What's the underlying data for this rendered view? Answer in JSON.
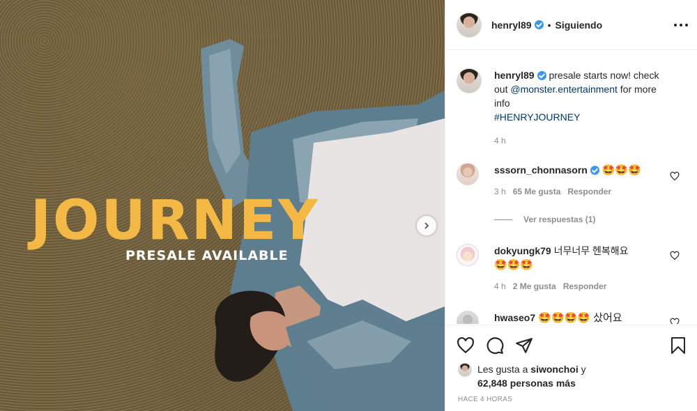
{
  "media": {
    "title": "JOURNEY",
    "subtitle": "PRESALE AVAILABLE",
    "next_icon": "chevron-right-icon"
  },
  "header": {
    "username": "henryl89",
    "separator": "•",
    "follow_status": "Siguiendo",
    "more_icon": "more-horizontal-icon"
  },
  "caption": {
    "username": "henryl89",
    "text": " presale starts now! check out ",
    "mention": "@monster.entertainment",
    "text_after": " for more info",
    "hashtag": "#HENRYJOURNEY",
    "time": "4 h"
  },
  "comments": [
    {
      "username": "sssorn_chonnasorn",
      "verified": true,
      "text": "🤩🤩🤩",
      "time": "3 h",
      "likes": "65 Me gusta",
      "reply": "Responder",
      "view_replies": "Ver respuestas (1)"
    },
    {
      "username": "dokyungk79",
      "text": " 너무너무 헨복해요",
      "text2": "🤩🤩🤩",
      "time": "4 h",
      "likes": "2 Me gusta",
      "reply": "Responder"
    },
    {
      "username": "hwaseo7",
      "text": " 🤩🤩🤩🤩 샀어요"
    }
  ],
  "actions": {
    "like_icon": "heart-icon",
    "comment_icon": "comment-icon",
    "share_icon": "send-icon",
    "save_icon": "bookmark-icon"
  },
  "likes": {
    "prefix": "Les gusta a ",
    "user": "siwonchoi",
    "mid": " y",
    "count": "62,848 personas más"
  },
  "timestamp": "HACE 4 HORAS",
  "colors": {
    "title_yellow": "#f3b944",
    "link_blue": "#00376b",
    "verified_blue": "#3897f0",
    "muted": "#8e8e8e"
  }
}
